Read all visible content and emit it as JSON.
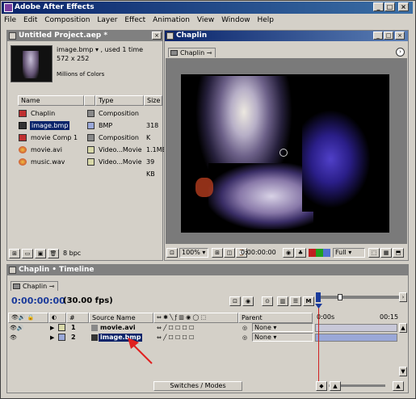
{
  "app": {
    "title": "Adobe After Effects"
  },
  "menu": [
    "File",
    "Edit",
    "Composition",
    "Layer",
    "Effect",
    "Animation",
    "View",
    "Window",
    "Help"
  ],
  "project": {
    "title": "Untitled Project.aep *",
    "selected_name": "image.bmp ▾ , used 1 time",
    "selected_dims": "572 x 252",
    "selected_colors": "Millions of Colors",
    "columns": {
      "name": "Name",
      "type": "Type",
      "size": "Size"
    },
    "items": [
      {
        "name": "Chaplin",
        "type": "Composition",
        "size": "",
        "color": "#888888"
      },
      {
        "name": "image.bmp",
        "type": "BMP",
        "size": "318 K",
        "color": "#9aa8d8"
      },
      {
        "name": "movie Comp 1",
        "type": "Composition",
        "size": "",
        "color": "#888888"
      },
      {
        "name": "movie.avi",
        "type": "Video...Movie",
        "size": "1.1MB",
        "color": "#d8d8a8"
      },
      {
        "name": "music.wav",
        "type": "Video...Movie",
        "size": "39 KB",
        "color": "#d8d8a8"
      }
    ],
    "bpc": "8 bpc"
  },
  "comp": {
    "window_title": "Chaplin",
    "tab": "Chaplin",
    "zoom": "100%",
    "timecode": "0:00:00:00",
    "resolution": "Full"
  },
  "timeline": {
    "window_title": "Chaplin • Timeline",
    "tab": "Chaplin",
    "timecode": "0:00:00:00",
    "fps": "(30.00 fps)",
    "col_source": "Source Name",
    "col_parent": "Parent",
    "ruler_start": "0:00s",
    "ruler_end": "00:15",
    "layers": [
      {
        "num": "1",
        "name": "movie.avi",
        "parent": "None"
      },
      {
        "num": "2",
        "name": "image.bmp",
        "parent": "None"
      }
    ],
    "switches_label": "Switches / Modes"
  }
}
